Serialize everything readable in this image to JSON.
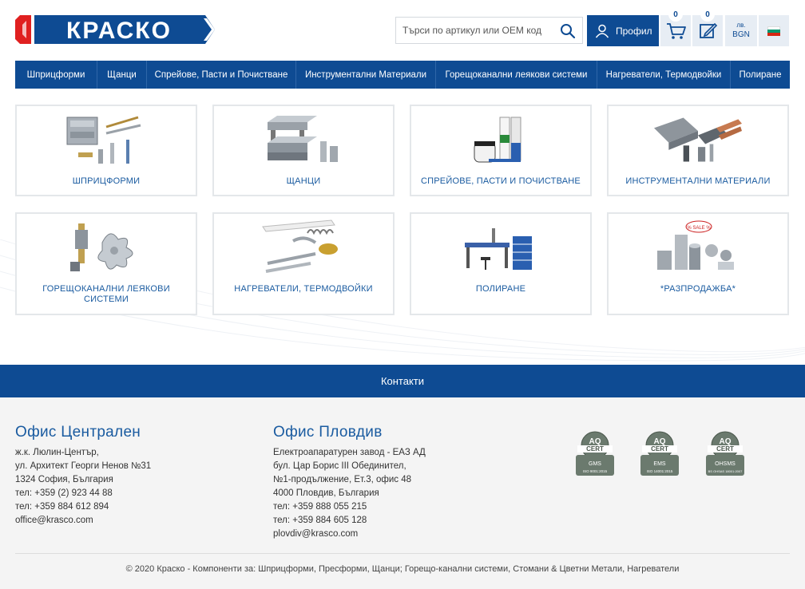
{
  "header": {
    "logo_text": "КРАСКО",
    "search_placeholder": "Търси по артикул или OEM код",
    "profile_label": "Профил",
    "cart_count": "0",
    "quote_count": "0",
    "currency_symbol": "лв.",
    "currency_code": "BGN",
    "flag_colors": [
      "#ffffff",
      "#00966e",
      "#d62612"
    ],
    "icons": [
      "search-icon",
      "user-icon",
      "cart-icon",
      "edit-icon",
      "bulgaria-flag-icon"
    ]
  },
  "nav": {
    "items": [
      {
        "label": "Шприцформи"
      },
      {
        "label": "Щанци"
      },
      {
        "label": "Спрейове, Пасти и Почистване"
      },
      {
        "label": "Инструментални Материали"
      },
      {
        "label": "Горещоканални леякови системи"
      },
      {
        "label": "Нагреватели, Термодвойки"
      },
      {
        "label": "Полиране"
      }
    ]
  },
  "categories": [
    {
      "label": "ШПРИЦФОРМИ",
      "icon": "injection-mould-parts-icon"
    },
    {
      "label": "ЩАНЦИ",
      "icon": "die-set-icon"
    },
    {
      "label": "СПРЕЙОВЕ, ПАСТИ И ПОЧИСТВАНЕ",
      "icon": "spray-cans-icon"
    },
    {
      "label": "ИНСТРУМЕНТАЛНИ МАТЕРИАЛИ",
      "icon": "metal-bars-icon"
    },
    {
      "label": "ГОРЕЩОКАНАЛНИ ЛЕЯКОВИ СИСТЕМИ",
      "icon": "hot-runner-icon"
    },
    {
      "label": "НАГРЕВАТЕЛИ, ТЕРМОДВОЙКИ",
      "icon": "heaters-icon"
    },
    {
      "label": "ПОЛИРАНЕ",
      "icon": "polishing-station-icon"
    },
    {
      "label": "*РАЗПРОДАЖБА*",
      "icon": "sale-items-icon",
      "sale_tag": "% SALE %"
    }
  ],
  "contacts_label": "Контакти",
  "offices": [
    {
      "title": "Офис Централен",
      "lines": [
        "ж.к. Люлин-Център,",
        "ул. Архитект Георги Ненов №31",
        "1324 София, България",
        "тел: +359 (2) 923 44 88",
        "тел: +359 884 612 894",
        "office@krasco.com"
      ]
    },
    {
      "title": "Офис Пловдив",
      "lines": [
        "Електроапаратурен завод - ЕАЗ АД",
        "бул. Цар Борис III Обединител,",
        "№1-продължение, Ет.3, офис 48",
        "4000 Пловдив, България",
        "тел: +359 888 055 215",
        "тел: +359 884 605 128",
        "plovdiv@krasco.com"
      ]
    }
  ],
  "certs": [
    {
      "name": "GMS",
      "std": "ISO 9001:2015"
    },
    {
      "name": "EMS",
      "std": "ISO 14001:2015"
    },
    {
      "name": "OHSMS",
      "std": "BS OHSAS 18001:2007"
    }
  ],
  "copyright": "© 2020 Краско - Компоненти за: Шприцформи, Пресформи, Щанци; Горещо-канални системи, Стомани & Цветни Метали, Нагреватели",
  "colors": {
    "brand": "#0e4b93",
    "link": "#1a5ba0",
    "logo_red": "#e02020"
  }
}
